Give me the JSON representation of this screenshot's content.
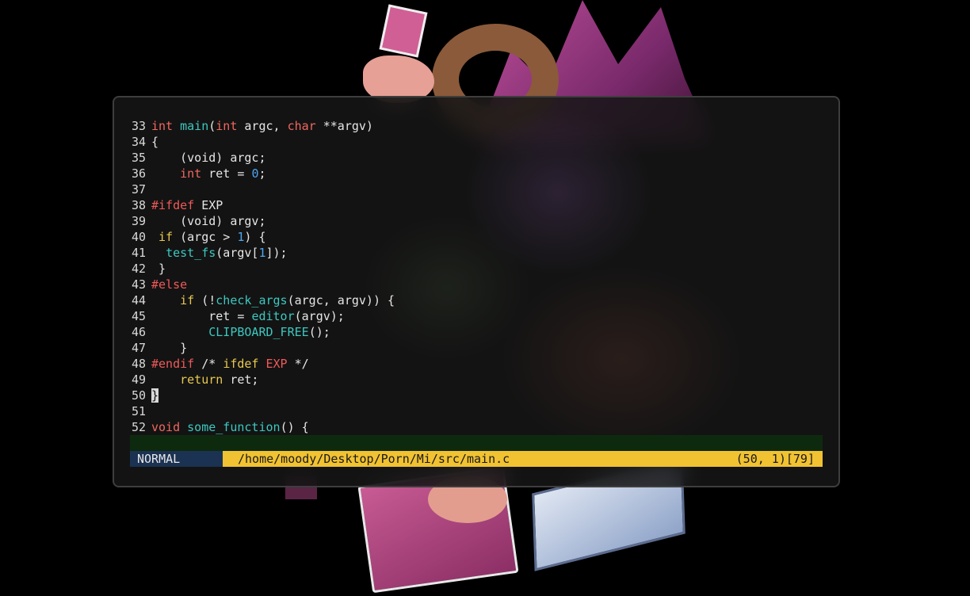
{
  "colors": {
    "background": "#000000",
    "terminal_bg": "#161616",
    "type_keyword": "#f0675f",
    "control_keyword": "#e8c850",
    "function": "#3cc8c0",
    "number": "#4ea6f0",
    "preprocessor": "#ef5a5a",
    "mode_bg": "#1b3252",
    "path_bg": "#f1c232",
    "cmd_bg": "#0e2a0e"
  },
  "editor": {
    "lines": [
      {
        "n": "33"
      },
      {
        "n": "34"
      },
      {
        "n": "35"
      },
      {
        "n": "36"
      },
      {
        "n": "37"
      },
      {
        "n": "38"
      },
      {
        "n": "39"
      },
      {
        "n": "40"
      },
      {
        "n": "41"
      },
      {
        "n": "42"
      },
      {
        "n": "43"
      },
      {
        "n": "44"
      },
      {
        "n": "45"
      },
      {
        "n": "46"
      },
      {
        "n": "47"
      },
      {
        "n": "48"
      },
      {
        "n": "49"
      },
      {
        "n": "50"
      },
      {
        "n": "51"
      },
      {
        "n": "52"
      }
    ],
    "tokens": {
      "l33": [
        "int",
        " ",
        "main",
        "(",
        "int",
        " argc, ",
        "char",
        " **argv)"
      ],
      "l34": [
        "{"
      ],
      "l35": [
        "    (void) argc;"
      ],
      "l36": [
        "    ",
        "int",
        " ret = ",
        "0",
        ";"
      ],
      "l37": [
        ""
      ],
      "l38": [
        "#ifdef",
        " EXP"
      ],
      "l39": [
        "    (void) argv;"
      ],
      "l40": [
        " ",
        "if",
        " (argc > ",
        "1",
        ") {"
      ],
      "l41": [
        "  ",
        "test_fs",
        "(argv[",
        "1",
        "]);"
      ],
      "l42": [
        " }"
      ],
      "l43": [
        "#else"
      ],
      "l44": [
        "    ",
        "if",
        " (!",
        "check_args",
        "(argc, argv)) {"
      ],
      "l45": [
        "        ret = ",
        "editor",
        "(argv);"
      ],
      "l46": [
        "        ",
        "CLIPBOARD_FREE",
        "();"
      ],
      "l47": [
        "    }"
      ],
      "l48": [
        "#endif",
        " /* ",
        "ifdef",
        " ",
        "EXP",
        " */"
      ],
      "l49": [
        "    ",
        "return",
        " ret;"
      ],
      "l50": [
        "}"
      ],
      "l51": [
        ""
      ],
      "l52": [
        "void",
        " ",
        "some_function",
        "() {"
      ]
    }
  },
  "statusline": {
    "mode": "NORMAL",
    "path": "/home/moody/Desktop/Porn/Mi/src/main.c",
    "position": "(50, 1)[79]"
  }
}
